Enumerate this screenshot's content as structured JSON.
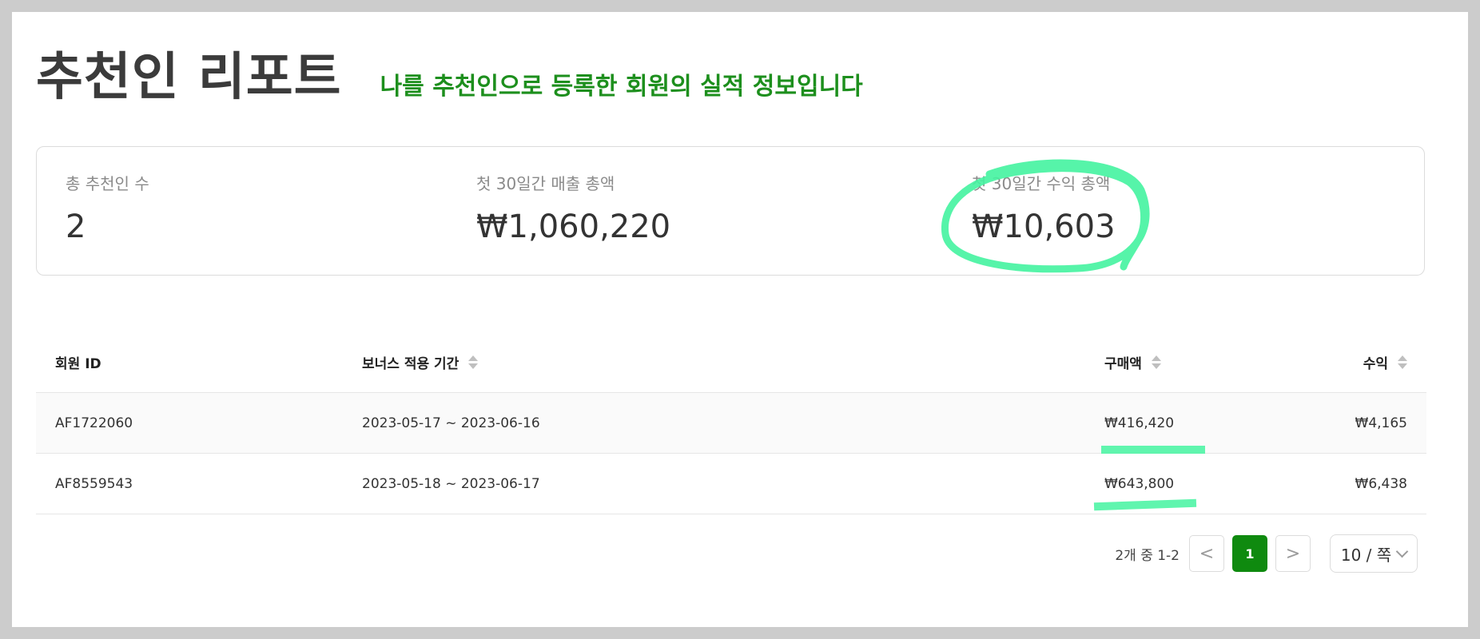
{
  "header": {
    "title": "추천인 리포트",
    "subtitle": "나를 추천인으로 등록한 회원의 실적 정보입니다"
  },
  "stats": [
    {
      "label": "총 추천인 수",
      "value": "2"
    },
    {
      "label": "첫 30일간 매출 총액",
      "value": "₩1,060,220"
    },
    {
      "label": "첫 30일간 수익 총액",
      "value": "₩10,603"
    }
  ],
  "table": {
    "columns": {
      "member_id": "회원 ID",
      "bonus_period": "보너스 적용 기간",
      "purchase": "구매액",
      "profit": "수익"
    },
    "rows": [
      {
        "member_id": "AF1722060",
        "bonus_period": "2023-05-17 ~ 2023-06-16",
        "purchase": "₩416,420",
        "profit": "₩4,165"
      },
      {
        "member_id": "AF8559543",
        "bonus_period": "2023-05-18 ~ 2023-06-17",
        "purchase": "₩643,800",
        "profit": "₩6,438"
      }
    ]
  },
  "pagination": {
    "total_text": "2개 중 1-2",
    "prev_label": "<",
    "current_page": "1",
    "next_label": ">",
    "page_size_label": "10 / 쪽"
  },
  "colors": {
    "accent": "#0f8a0f",
    "subtitle": "#1d8f1d",
    "annotation": "#44f3a0"
  }
}
